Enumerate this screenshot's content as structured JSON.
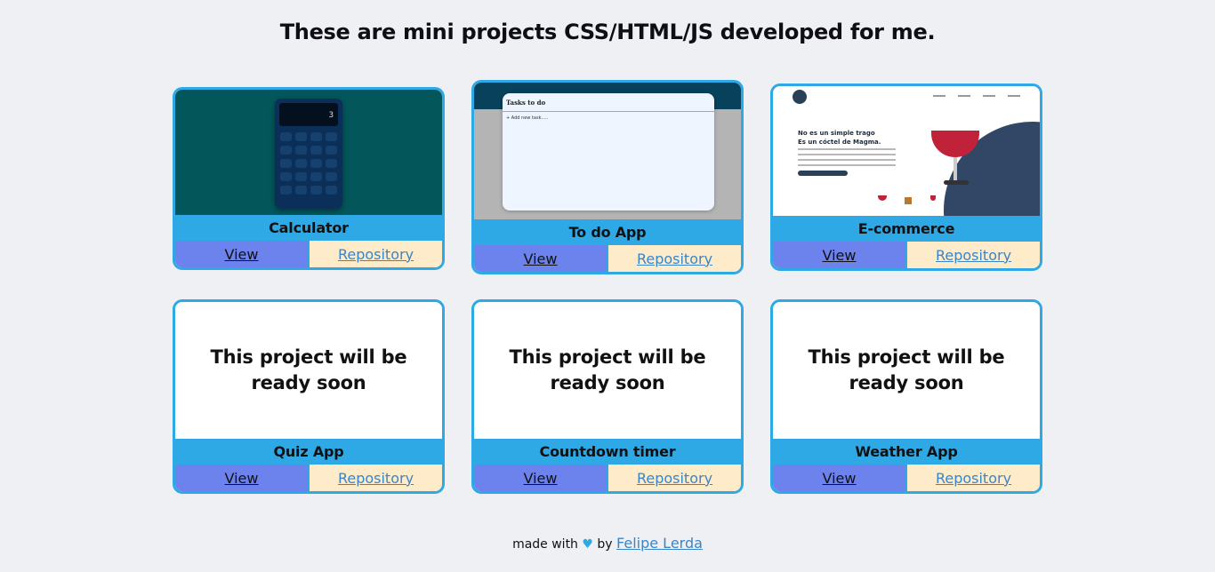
{
  "page": {
    "title": "These are mini projects CSS/HTML/JS developed for me."
  },
  "projects": [
    {
      "name": "Calculator",
      "view_label": "View",
      "repo_label": "Repository",
      "thumbnail": "calculator-preview",
      "screen_value": "3"
    },
    {
      "name": "To do App",
      "view_label": "View",
      "repo_label": "Repository",
      "thumbnail": "todo-preview",
      "panel_title": "Tasks to do",
      "add_label": "+ Add new task....."
    },
    {
      "name": "E-commerce",
      "view_label": "View",
      "repo_label": "Repository",
      "thumbnail": "ecommerce-preview",
      "headline_1": "No es un simple trago",
      "headline_2": "Es un cóctel de Magma."
    },
    {
      "name": "Quiz App",
      "view_label": "View",
      "repo_label": "Repository",
      "placeholder": "This project will be ready soon"
    },
    {
      "name": "Countdown timer",
      "view_label": "View",
      "repo_label": "Repository",
      "placeholder": "This project will be ready soon"
    },
    {
      "name": "Weather App",
      "view_label": "View",
      "repo_label": "Repository",
      "placeholder": "This project will be ready soon"
    }
  ],
  "footer": {
    "prefix": "made with",
    "heart": "♥",
    "by": "by",
    "author": "Felipe Lerda"
  },
  "colors": {
    "background": "#eff0f3",
    "card_border": "#2fa9e6",
    "view_button": "#6c83ee",
    "repo_button": "#fdebc9",
    "link": "#3a85c8"
  }
}
